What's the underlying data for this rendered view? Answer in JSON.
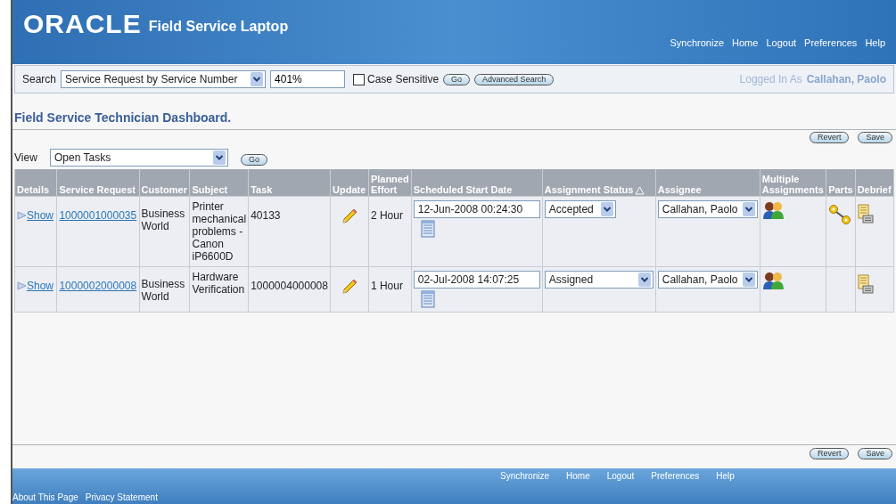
{
  "header": {
    "logo": "ORACLE",
    "product": "Field Service Laptop",
    "links": [
      "Synchronize",
      "Home",
      "Logout",
      "Preferences",
      "Help"
    ]
  },
  "search": {
    "label": "Search",
    "type": "Service Request by Service Number",
    "value": "401%",
    "case_sensitive": {
      "label": "Case Sensitive",
      "checked": false
    },
    "go": "Go",
    "advanced": "Advanced Search",
    "logged_in_label": "Logged In As",
    "user": "Callahan, Paolo"
  },
  "page_title": "Field Service Technician Dashboard.",
  "top_buttons": [
    "Revert",
    "Save"
  ],
  "view": {
    "label": "View",
    "value": "Open Tasks",
    "go": "Go"
  },
  "table": {
    "columns": [
      {
        "label": "Details",
        "sorted": false
      },
      {
        "label": "Service Request",
        "sorted": false
      },
      {
        "label": "Customer",
        "sorted": false
      },
      {
        "label": "Subject",
        "sorted": false
      },
      {
        "label": "Task",
        "sorted": false
      },
      {
        "label": "Update",
        "sorted": false
      },
      {
        "label": "Planned Effort",
        "sorted": false
      },
      {
        "label": "Scheduled Start Date",
        "sorted": false
      },
      {
        "label": "Assignment Status",
        "sorted": true
      },
      {
        "label": "Assignee",
        "sorted": false
      },
      {
        "label": "Multiple Assignments",
        "sorted": false
      },
      {
        "label": "Parts",
        "sorted": false
      },
      {
        "label": "Debrief",
        "sorted": false
      }
    ],
    "rows": [
      {
        "details": "Show",
        "service_request": "1000001000035",
        "customer": "Business World",
        "subject": "Printer mechanical problems - Canon iP6600D",
        "task": "40133",
        "effort": "2 Hour",
        "start_date": "12-Jun-2008 00:24:30",
        "status": "Accepted",
        "assignee": "Callahan, Paolo",
        "parts": true
      },
      {
        "details": "Show",
        "service_request": "1000002000008",
        "customer": "Business World",
        "subject": "Hardware Verification",
        "task": "1000004000008",
        "effort": "1 Hour",
        "start_date": "02-Jul-2008 14:07:25",
        "status": "Assigned",
        "assignee": "Callahan, Paolo",
        "parts": false
      }
    ]
  },
  "bottom_buttons": [
    "Revert",
    "Save"
  ],
  "footer": {
    "links": [
      "Synchronize",
      "Home",
      "Logout",
      "Preferences",
      "Help"
    ],
    "bottom_links": [
      "About This Page",
      "Privacy Statement"
    ]
  }
}
